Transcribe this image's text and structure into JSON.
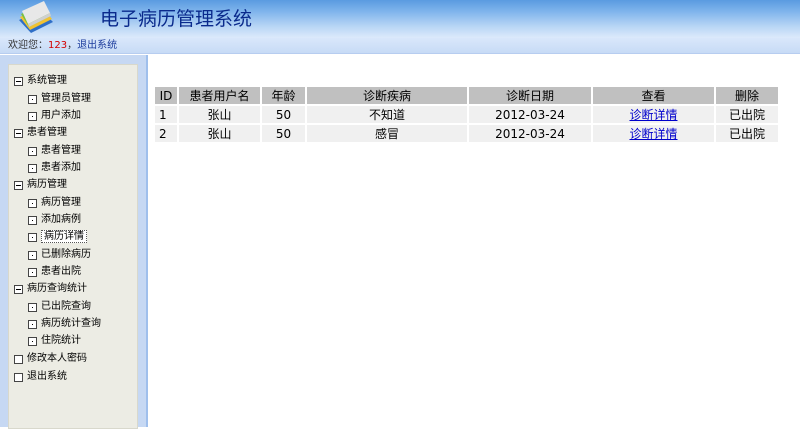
{
  "header": {
    "title": "电子病历管理系统"
  },
  "welcome": {
    "prefix": "欢迎您：",
    "user": "123",
    "separator": "，",
    "logout_link": "退出系统"
  },
  "sidebar": {
    "groups": [
      {
        "label": "系统管理",
        "children": [
          "管理员管理",
          "用户添加"
        ]
      },
      {
        "label": "患者管理",
        "children": [
          "患者管理",
          "患者添加"
        ]
      },
      {
        "label": "病历管理",
        "children": [
          "病历管理",
          "添加病例",
          "病历详情",
          "已删除病历",
          "患者出院"
        ]
      },
      {
        "label": "病历查询统计",
        "children": [
          "已出院查询",
          "病历统计查询",
          "住院统计"
        ]
      },
      {
        "label": "修改本人密码",
        "children": []
      },
      {
        "label": "退出系统",
        "children": []
      }
    ],
    "selected": "病历详情"
  },
  "table": {
    "headers": [
      "ID",
      "患者用户名",
      "年龄",
      "诊断疾病",
      "诊断日期",
      "查看",
      "删除"
    ],
    "rows": [
      {
        "id": "1",
        "name": "张山",
        "age": "50",
        "disease": "不知道",
        "date": "2012-03-24",
        "view": "诊断详情",
        "status": "已出院"
      },
      {
        "id": "2",
        "name": "张山",
        "age": "50",
        "disease": "感冒",
        "date": "2012-03-24",
        "view": "诊断详情",
        "status": "已出院"
      }
    ]
  }
}
